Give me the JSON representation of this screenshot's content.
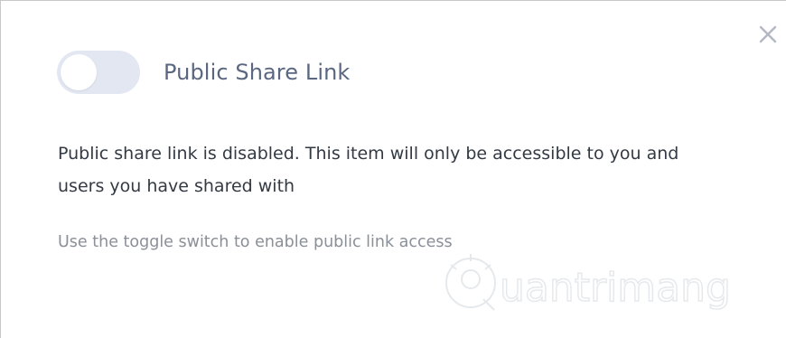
{
  "dialog": {
    "close_icon": "close-icon",
    "toggle": {
      "state": "off",
      "track_color": "#e3e7f2",
      "knob_color": "#ffffff"
    },
    "title": "Public Share Link",
    "description": "Public share link is disabled. This item will only be accessible to you and users you have shared with",
    "hint": "Use the toggle switch to enable public link access"
  },
  "watermark": {
    "text": "uantrimang"
  },
  "colors": {
    "title": "#5b6781",
    "body_text": "#333a44",
    "hint_text": "#8a8f98",
    "close_icon": "#b3b8c2"
  }
}
